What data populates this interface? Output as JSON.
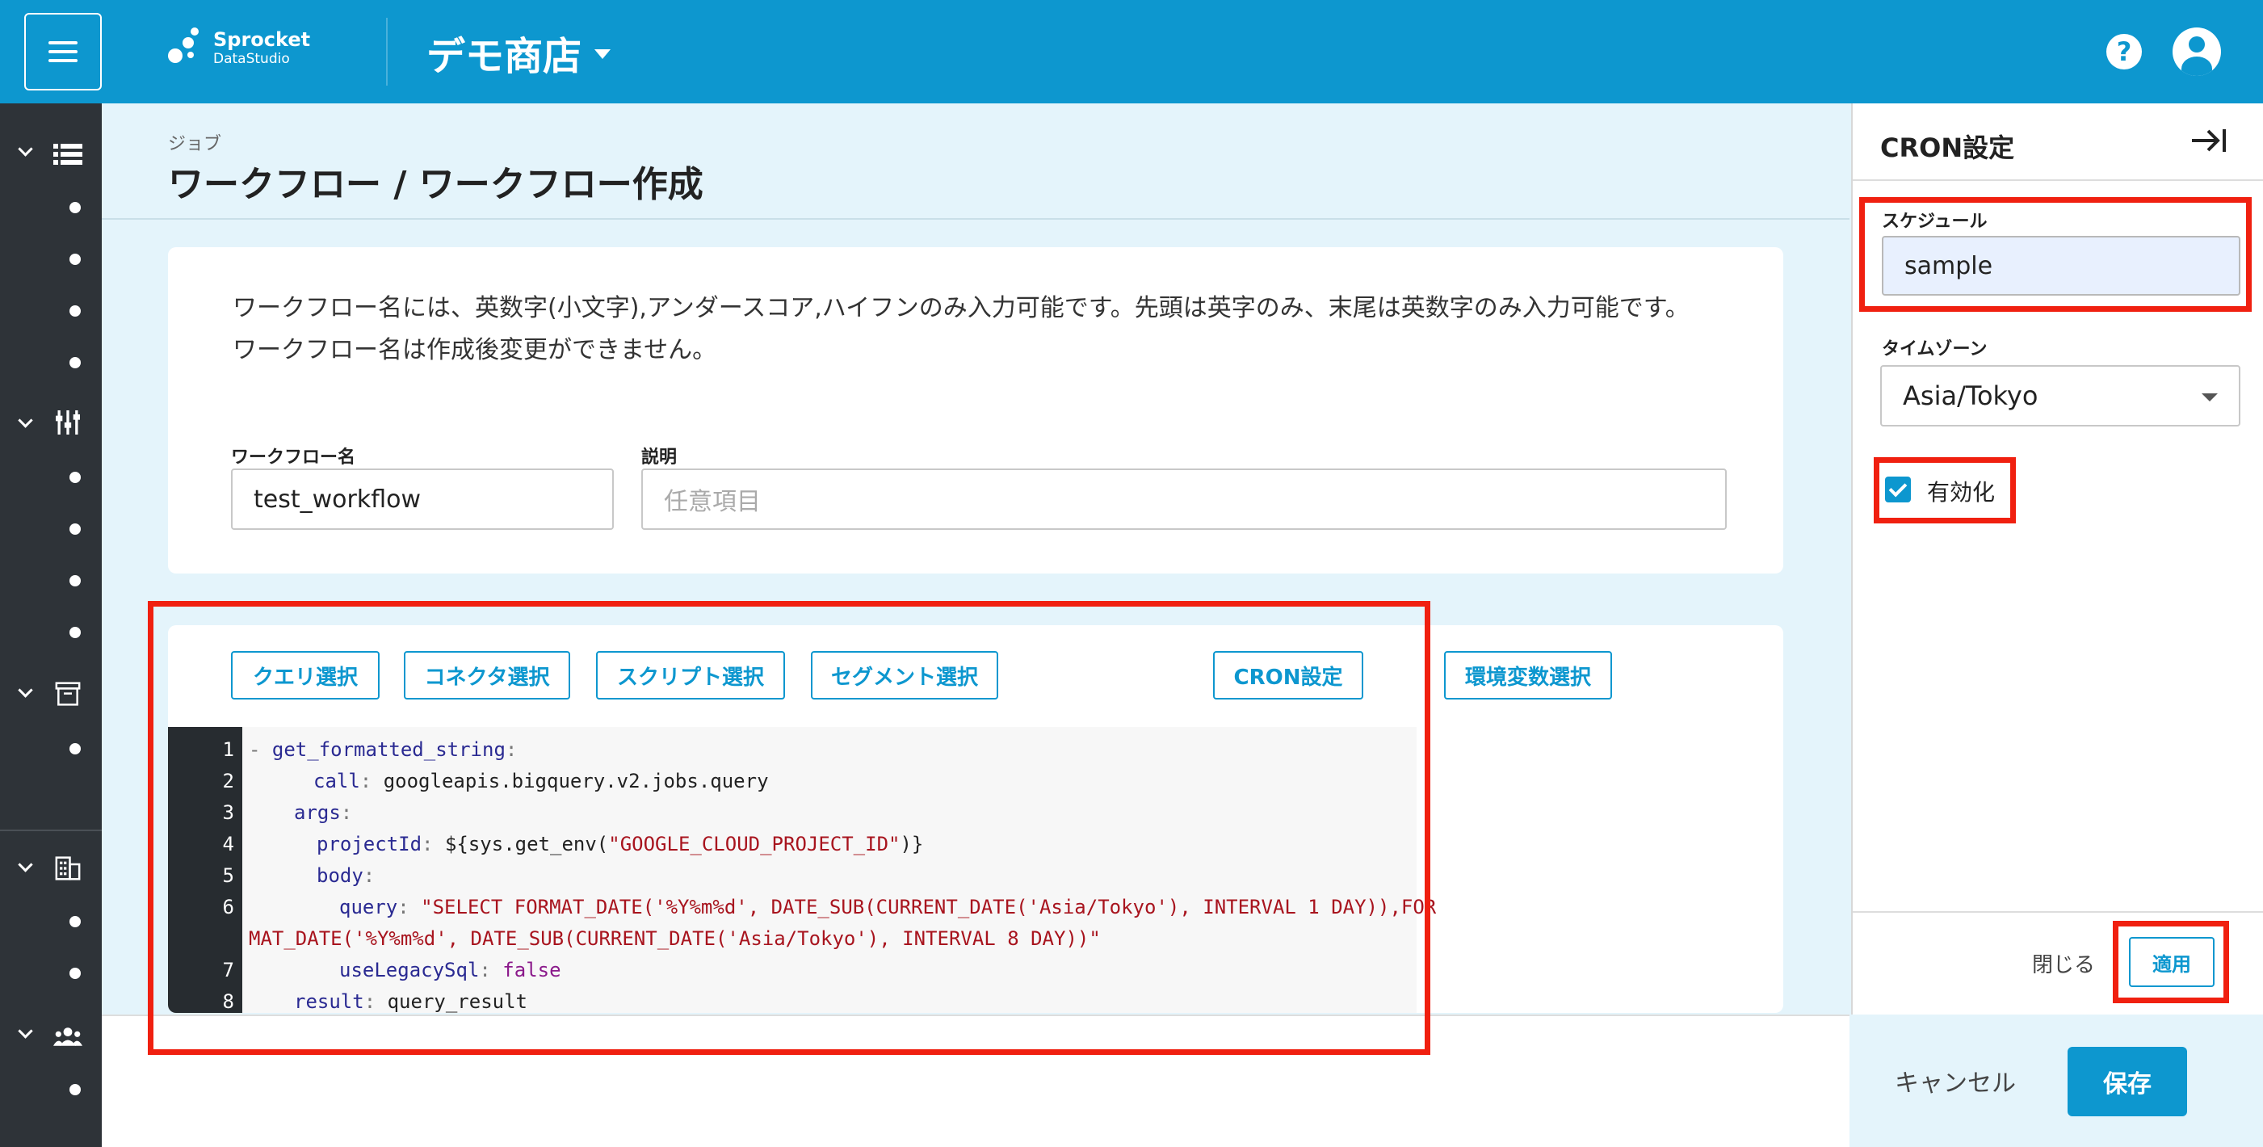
{
  "header": {
    "logo_line1": "Sprocket",
    "logo_line2": "DataStudio",
    "shop_name": "デモ商店",
    "help_glyph": "?"
  },
  "page": {
    "breadcrumb_small": "ジョブ",
    "title": "ワークフロー / ワークフロー作成"
  },
  "notice": {
    "line1": "ワークフロー名には、英数字(小文字),アンダースコア,ハイフンのみ入力可能です。先頭は英字のみ、末尾は英数字のみ入力可能です。",
    "line2": "ワークフロー名は作成後変更ができません。"
  },
  "form": {
    "name_label": "ワークフロー名",
    "name_value": "test_workflow",
    "desc_label": "説明",
    "desc_placeholder": "任意項目"
  },
  "toolbar": {
    "query_select": "クエリ選択",
    "connector_select": "コネクタ選択",
    "script_select": "スクリプト選択",
    "segment_select": "セグメント選択",
    "cron_settings": "CRON設定",
    "env_select": "環境変数選択"
  },
  "editor": {
    "line_numbers": [
      "1",
      "2",
      "3",
      "4",
      "5",
      "6",
      "7",
      "8"
    ],
    "l1_dash": "- ",
    "l1_key": "get_formatted_string",
    "l2_key": "call",
    "l2_val": " googleapis.bigquery.v2.jobs.query",
    "l3_key": "args",
    "l4_key": "projectId",
    "l4_val1": " ${sys.get_env(",
    "l4_str": "\"GOOGLE_CLOUD_PROJECT_ID\"",
    "l4_val2": ")}",
    "l5_key": "body",
    "l6_key": "query",
    "l6_str_a": " \"SELECT FORMAT_DATE('%Y%m%d', DATE_SUB(CURRENT_DATE('Asia/Tokyo'), INTERVAL 1 DAY)),FOR",
    "l6_str_b": "MAT_DATE('%Y%m%d', DATE_SUB(CURRENT_DATE('Asia/Tokyo'), INTERVAL 8 DAY))\"",
    "l7_key": "useLegacySql",
    "l7_val": " false",
    "l8_key": "result",
    "l8_val": " query_result",
    "colon": ":"
  },
  "footer": {
    "cancel": "キャンセル",
    "save": "保存"
  },
  "cron_panel": {
    "title": "CRON設定",
    "schedule_label": "スケジュール",
    "schedule_value": "sample",
    "timezone_label": "タイムゾーン",
    "timezone_value": "Asia/Tokyo",
    "enable_label": "有効化",
    "enabled": true,
    "close": "閉じる",
    "apply": "適用"
  },
  "colors": {
    "brand": "#0d97cf",
    "sidebar": "#2e3338",
    "highlight": "#f02010"
  }
}
